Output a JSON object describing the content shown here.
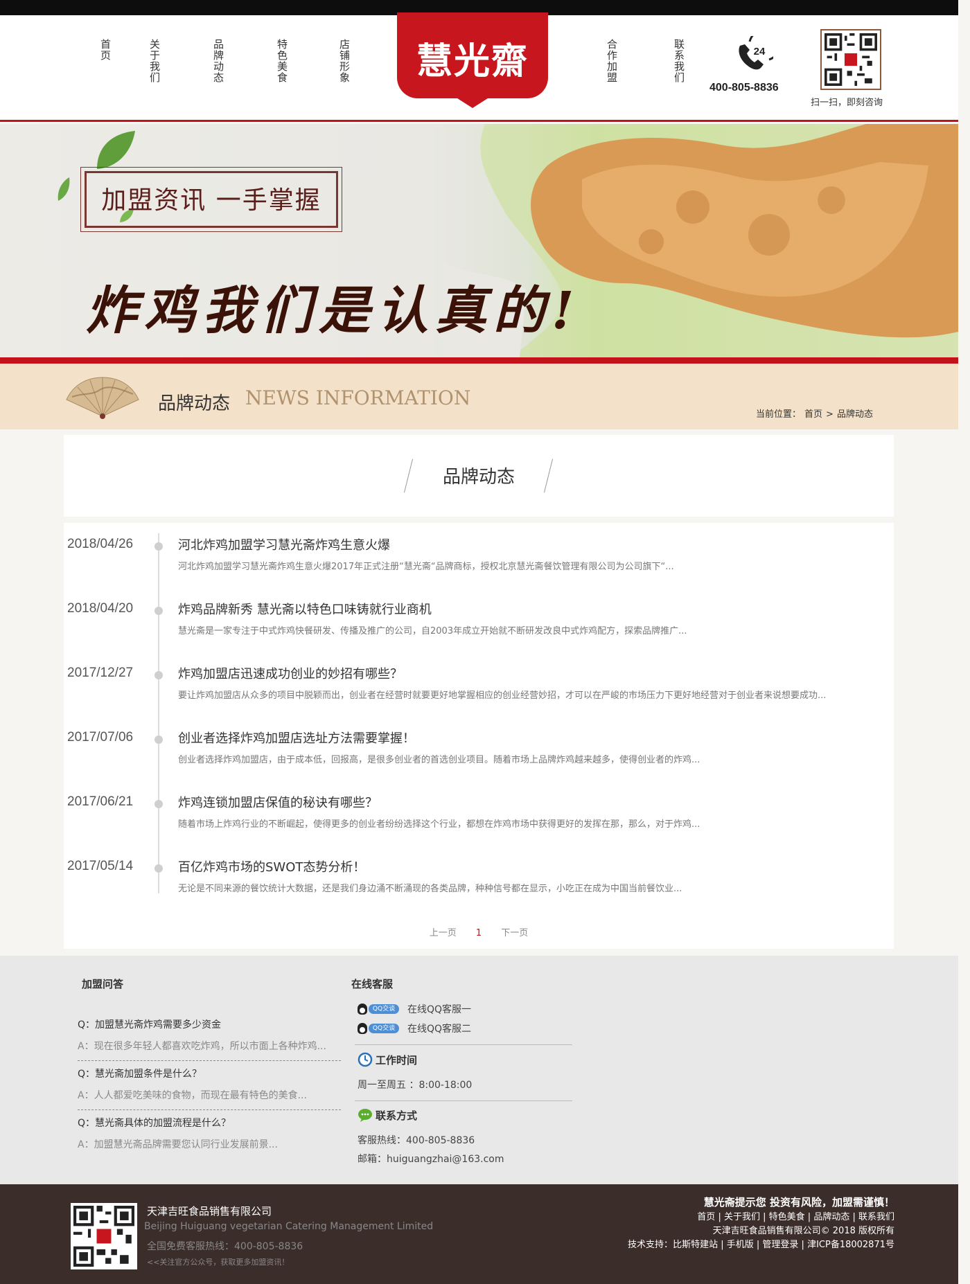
{
  "header": {
    "nav_left": [
      "首页",
      "关于我们",
      "品牌动态",
      "特色美食",
      "店铺形象"
    ],
    "nav_right": [
      "合作加盟",
      "联系我们"
    ],
    "logo_text": "慧光齋",
    "phone_badge": "24",
    "phone_number": "400-805-8836",
    "qr_caption": "扫一扫，即刻咨询"
  },
  "banner": {
    "frame_text": "加盟资讯  一手掌握",
    "slogan": "炸鸡我们是认真的!"
  },
  "section": {
    "title_cn": "品牌动态",
    "title_en": "NEWS INFORMATION",
    "breadcrumb_label": "当前位置：",
    "breadcrumb_home": "首页",
    "breadcrumb_sep": ">",
    "breadcrumb_current": "品牌动态"
  },
  "card": {
    "heading": "品牌动态"
  },
  "news": [
    {
      "date": "2018/04/26",
      "title": "河北炸鸡加盟学习慧光斋炸鸡生意火爆",
      "summary": "河北炸鸡加盟学习慧光斋炸鸡生意火爆2017年正式注册“慧光斋“品牌商标，授权北京慧光斋餐饮管理有限公司为公司旗下“..."
    },
    {
      "date": "2018/04/20",
      "title": "炸鸡品牌新秀 慧光斋以特色口味铸就行业商机",
      "summary": "慧光斋是一家专注于中式炸鸡快餐研发、传播及推广的公司，自2003年成立开始就不断研发改良中式炸鸡配方，探索品牌推广..."
    },
    {
      "date": "2017/12/27",
      "title": "炸鸡加盟店迅速成功创业的妙招有哪些？",
      "summary": "要让炸鸡加盟店从众多的项目中脱颖而出，创业者在经营时就要更好地掌握相应的创业经营妙招，才可以在严峻的市场压力下更好地经营对于创业者来说想要成功..."
    },
    {
      "date": "2017/07/06",
      "title": "创业者选择炸鸡加盟店选址方法需要掌握！",
      "summary": "创业者选择炸鸡加盟店，由于成本低，回报高，是很多创业者的首选创业项目。随着市场上品牌炸鸡越来越多，使得创业者的炸鸡..."
    },
    {
      "date": "2017/06/21",
      "title": "炸鸡连锁加盟店保值的秘诀有哪些？",
      "summary": "随着市场上炸鸡行业的不断崛起，使得更多的创业者纷纷选择这个行业，都想在炸鸡市场中获得更好的发挥在那，那么，对于炸鸡..."
    },
    {
      "date": "2017/05/14",
      "title": "百亿炸鸡市场的SWOT态势分析！",
      "summary": "无论是不同来源的餐饮统计大数据，还是我们身边涌不断涌现的各类品牌，种种信号都在显示，小吃正在成为中国当前餐饮业..."
    }
  ],
  "pager": {
    "prev": "上一页",
    "current": "1",
    "next": "下一页"
  },
  "faq": {
    "title": "加盟问答",
    "items": [
      {
        "q": "Q：加盟慧光斋炸鸡需要多少资金",
        "a": "A：现在很多年轻人都喜欢吃炸鸡，所以市面上各种炸鸡..."
      },
      {
        "q": "Q：慧光斋加盟条件是什么？",
        "a": "A：人人都爱吃美味的食物，而现在最有特色的美食..."
      },
      {
        "q": "Q：慧光斋具体的加盟流程是什么？",
        "a": "A：加盟慧光斋品牌需要您认同行业发展前景..."
      }
    ]
  },
  "service": {
    "title": "在线客服",
    "qq_badge": "QQ交谈",
    "qq": [
      "在线QQ客服一",
      "在线QQ客服二"
    ],
    "hours_title": "工作时间",
    "hours": "周一至周五 ：8:00-18:00",
    "contact_title": "联系方式",
    "hotline": "客服热线：400-805-8836",
    "email": "邮箱：huiguangzhai@163.com"
  },
  "footer": {
    "company": "天津吉旺食品销售有限公司",
    "company_en": "Beijing Huiguang vegetarian Catering Management Limited",
    "hotline": "全国免费客服热线：400-805-8836",
    "follow": "<<关注官方公众号，获取更多加盟资讯！",
    "warning": "慧光斋提示您 投资有风险，加盟需谨慎！",
    "links": [
      "首页",
      "关于我们",
      "特色美食",
      "品牌动态",
      "联系我们"
    ],
    "copyright": "天津吉旺食品销售有限公司© 2018  版权所有",
    "support_label": "技术支持：",
    "support": [
      "比斯特建站",
      "手机版",
      "管理登录",
      "津ICP备18002871号"
    ]
  },
  "colors": {
    "brand_red": "#c7161d",
    "footer_bg": "#3b2d2a",
    "titlebar_bg": "#f3e2c9"
  }
}
